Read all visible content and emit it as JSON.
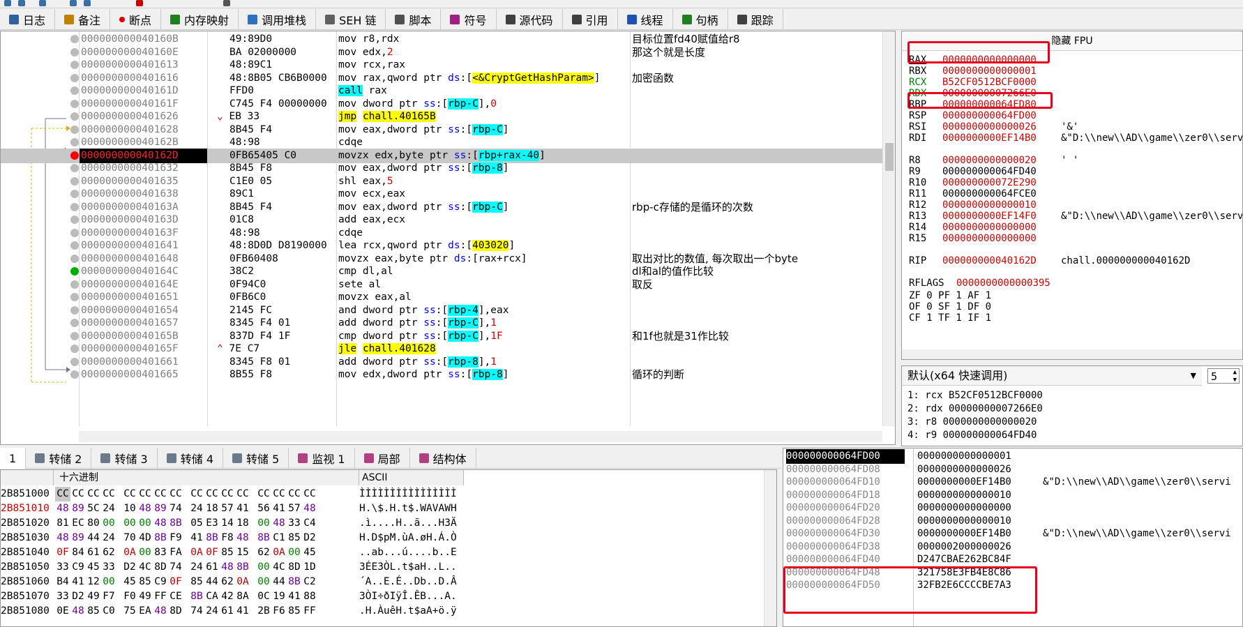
{
  "toolbar_icons": [
    "step-icon",
    "run-icon",
    "pause-icon",
    "step-over-icon",
    "breakpoint-icon",
    "font-icon",
    "hash-icon"
  ],
  "tabs_top": [
    {
      "label": "日志",
      "icon": "log-icon",
      "color": "#3060a0"
    },
    {
      "label": "备注",
      "icon": "notes-icon",
      "color": "#c08000"
    },
    {
      "label": "断点",
      "icon": "breakpoint-dot-icon",
      "color": "#e00000"
    },
    {
      "label": "内存映射",
      "icon": "memory-map-icon",
      "color": "#208020"
    },
    {
      "label": "调用堆栈",
      "icon": "callstack-icon",
      "color": "#3070c0"
    },
    {
      "label": "SEH 链",
      "icon": "seh-icon",
      "color": "#606060"
    },
    {
      "label": "脚本",
      "icon": "script-icon",
      "color": "#505050"
    },
    {
      "label": "符号",
      "icon": "symbol-icon",
      "color": "#a02080"
    },
    {
      "label": "源代码",
      "icon": "source-icon",
      "color": "#404040"
    },
    {
      "label": "引用",
      "icon": "reference-icon",
      "color": "#404040"
    },
    {
      "label": "线程",
      "icon": "thread-icon",
      "color": "#2050b0"
    },
    {
      "label": "句柄",
      "icon": "handle-icon",
      "color": "#208020"
    },
    {
      "label": "跟踪",
      "icon": "trace-icon",
      "color": "#404040"
    }
  ],
  "disasm": [
    {
      "addr": "000000000040160B",
      "bytes": "49:89D0",
      "ins": "mov r8,rdx",
      "comment": "目标位置fd40赋值给r8"
    },
    {
      "addr": "000000000040160E",
      "bytes": "BA 02000000",
      "ins": "mov edx,2",
      "comment": "那这个就是长度"
    },
    {
      "addr": "0000000000401613",
      "bytes": "48:89C1",
      "ins": "mov rcx,rax",
      "comment": ""
    },
    {
      "addr": "0000000000401616",
      "bytes": "48:8B05 CB6B0000",
      "ins": "mov rax,qword ptr ds:[<&CryptGetHashParam>]",
      "comment": "加密函数"
    },
    {
      "addr": "000000000040161D",
      "bytes": "FFD0",
      "ins": "call rax",
      "comment": ""
    },
    {
      "addr": "000000000040161F",
      "bytes": "C745 F4 00000000",
      "ins": "mov dword ptr ss:[rbp-C],0",
      "comment": ""
    },
    {
      "addr": "0000000000401626",
      "bytes": "EB 33",
      "ins": "jmp chall.40165B",
      "comment": ""
    },
    {
      "addr": "0000000000401628",
      "bytes": "8B45 F4",
      "ins": "mov eax,dword ptr ss:[rbp-C]",
      "comment": ""
    },
    {
      "addr": "000000000040162B",
      "bytes": "48:98",
      "ins": "cdqe",
      "comment": ""
    },
    {
      "addr": "000000000040162D",
      "bytes": "0FB65405 C0",
      "ins": "movzx edx,byte ptr ss:[rbp+rax-40]",
      "comment": ""
    },
    {
      "addr": "0000000000401632",
      "bytes": "8B45 F8",
      "ins": "mov eax,dword ptr ss:[rbp-8]",
      "comment": ""
    },
    {
      "addr": "0000000000401635",
      "bytes": "C1E0 05",
      "ins": "shl eax,5",
      "comment": ""
    },
    {
      "addr": "0000000000401638",
      "bytes": "89C1",
      "ins": "mov ecx,eax",
      "comment": ""
    },
    {
      "addr": "000000000040163A",
      "bytes": "8B45 F4",
      "ins": "mov eax,dword ptr ss:[rbp-C]",
      "comment": "rbp-c存储的是循环的次数"
    },
    {
      "addr": "000000000040163D",
      "bytes": "01C8",
      "ins": "add eax,ecx",
      "comment": ""
    },
    {
      "addr": "000000000040163F",
      "bytes": "48:98",
      "ins": "cdqe",
      "comment": ""
    },
    {
      "addr": "0000000000401641",
      "bytes": "48:8D0D D8190000",
      "ins": "lea rcx,qword ptr ds:[403020]",
      "comment": ""
    },
    {
      "addr": "0000000000401648",
      "bytes": "0FB60408",
      "ins": "movzx eax,byte ptr ds:[rax+rcx]",
      "comment": "取出对比的数值, 每次取出一个byte"
    },
    {
      "addr": "000000000040164C",
      "bytes": "38C2",
      "ins": "cmp dl,al",
      "comment": "dl和al的值作比较"
    },
    {
      "addr": "000000000040164E",
      "bytes": "0F94C0",
      "ins": "sete al",
      "comment": "取反"
    },
    {
      "addr": "0000000000401651",
      "bytes": "0FB6C0",
      "ins": "movzx eax,al",
      "comment": ""
    },
    {
      "addr": "0000000000401654",
      "bytes": "2145 FC",
      "ins": "and dword ptr ss:[rbp-4],eax",
      "comment": ""
    },
    {
      "addr": "0000000000401657",
      "bytes": "8345 F4 01",
      "ins": "add dword ptr ss:[rbp-C],1",
      "comment": ""
    },
    {
      "addr": "000000000040165B",
      "bytes": "837D F4 1F",
      "ins": "cmp dword ptr ss:[rbp-C],1F",
      "comment": "和1f也就是31作比较"
    },
    {
      "addr": "000000000040165F",
      "bytes": "7E C7",
      "ins": "jle chall.401628",
      "comment": ""
    },
    {
      "addr": "0000000000401661",
      "bytes": "8345 F8 01",
      "ins": "add dword ptr ss:[rbp-8],1",
      "comment": ""
    },
    {
      "addr": "0000000000401665",
      "bytes": "8B55 F8",
      "ins": "mov edx,dword ptr ss:[rbp-8]",
      "comment": "循环的判断"
    }
  ],
  "regs_header": "隐藏 FPU",
  "registers": [
    {
      "name": "RAX",
      "val": "0000000000000000",
      "desc": ""
    },
    {
      "name": "RBX",
      "val": "0000000000000001",
      "desc": ""
    },
    {
      "name": "RCX",
      "val": "B52CF0512BCF0000",
      "desc": ""
    },
    {
      "name": "RDX",
      "val": "00000000007266E0",
      "desc": ""
    },
    {
      "name": "RBP",
      "val": "000000000064FD80",
      "desc": ""
    },
    {
      "name": "RSP",
      "val": "000000000064FD00",
      "desc": ""
    },
    {
      "name": "RSI",
      "val": "0000000000000026",
      "desc": "'&'"
    },
    {
      "name": "RDI",
      "val": "0000000000EF14B0",
      "desc": "&\"D:\\\\new\\\\AD\\\\game\\\\zer0\\\\service"
    },
    {
      "name": "R8",
      "val": "0000000000000020",
      "desc": "' '"
    },
    {
      "name": "R9",
      "val": "000000000064FD40",
      "desc": ""
    },
    {
      "name": "R10",
      "val": "000000000072E290",
      "desc": ""
    },
    {
      "name": "R11",
      "val": "000000000064FCE0",
      "desc": ""
    },
    {
      "name": "R12",
      "val": "0000000000000010",
      "desc": ""
    },
    {
      "name": "R13",
      "val": "0000000000EF14F0",
      "desc": "&\"D:\\\\new\\\\AD\\\\game\\\\zer0\\\\service"
    },
    {
      "name": "R14",
      "val": "0000000000000000",
      "desc": ""
    },
    {
      "name": "R15",
      "val": "0000000000000000",
      "desc": ""
    },
    {
      "name": "RIP",
      "val": "000000000040162D",
      "desc": "chall.000000000040162D"
    }
  ],
  "rflags": {
    "name": "RFLAGS",
    "val": "0000000000000395"
  },
  "flags_rows": [
    "ZF 0  PF 1  AF 1",
    "OF 0  SF 1  DF 0",
    "CF 1  TF 1  IF 1"
  ],
  "callconv": {
    "label": "默认(x64 快速调用)",
    "count": "5",
    "args": [
      "1: rcx B52CF0512BCF0000",
      "2: rdx 00000000007266E0",
      "3: r8 0000000000000020",
      "4: r9 000000000064FD40"
    ]
  },
  "tabs_bottom": [
    {
      "label": "1",
      "icon": ""
    },
    {
      "label": "转储 2",
      "icon": "dump-icon"
    },
    {
      "label": "转储 3",
      "icon": "dump-icon"
    },
    {
      "label": "转储 4",
      "icon": "dump-icon"
    },
    {
      "label": "转储 5",
      "icon": "dump-icon"
    },
    {
      "label": "监视 1",
      "icon": "watch-icon"
    },
    {
      "label": "局部",
      "icon": "locals-icon"
    },
    {
      "label": "结构体",
      "icon": "struct-icon"
    }
  ],
  "dump_headers": {
    "hex": "十六进制",
    "ascii": "ASCII"
  },
  "dump": [
    {
      "addr": "2B851000",
      "bytes": "CC CC CC CC CC CC CC CC CC CC CC CC CC CC CC CC",
      "ascii": "ÌÌÌÌÌÌÌÌÌÌÌÌÌÌÌÌ"
    },
    {
      "addr": "2B851010",
      "bytes": "48 89 5C 24 10 48 89 74 24 18 57 41 56 41 57 48",
      "ascii": "H.\\$.H.t$.WAVAWH"
    },
    {
      "addr": "2B851020",
      "bytes": "81 EC 80 00 00 00 48 8B 05 E3 14 18 00 48 33 C4",
      "ascii": ".ì....H..ã...H3Ä"
    },
    {
      "addr": "2B851030",
      "bytes": "48 89 44 24 70 4D 8B F9 41 8B F8 48 8B C1 85 D2",
      "ascii": "H.D$pM.ùA.øH.Á.Ò"
    },
    {
      "addr": "2B851040",
      "bytes": "0F 84 61 62 0A 00 83 FA 0A 0F 85 15 62 0A 00 45",
      "ascii": "..ab...ú....b..E"
    },
    {
      "addr": "2B851050",
      "bytes": "33 C9 45 33 D2 4C 8D 74 24 61 48 8B 00 4C 8D 1D",
      "ascii": "3ÉE3ÒL.t$aH..L.."
    },
    {
      "addr": "2B851060",
      "bytes": "B4 41 12 00 45 85 C9 0F 85 44 62 0A 00 44 8B C2",
      "ascii": "´A..E.É..Db..D.Â"
    },
    {
      "addr": "2B851070",
      "bytes": "33 D2 49 F7 F0 49 FF CE 8B CA 42 8A 0C 19 41 88",
      "ascii": "3ÒI÷ðIÿÎ.ÊB...A."
    },
    {
      "addr": "2B851080",
      "bytes": "0E 48 85 C0 75 EA 48 8D 74 24 61 41 2B F6 85 FF",
      "ascii": ".H.ÀuêH.t$aA+ö.ÿ"
    }
  ],
  "stack": [
    {
      "addr": "000000000064FD00",
      "val": "0000000000000001",
      "comment": "",
      "current": true
    },
    {
      "addr": "000000000064FD08",
      "val": "0000000000000026",
      "comment": ""
    },
    {
      "addr": "000000000064FD10",
      "val": "0000000000EF14B0",
      "comment": "&\"D:\\\\new\\\\AD\\\\game\\\\zer0\\\\servi"
    },
    {
      "addr": "000000000064FD18",
      "val": "0000000000000010",
      "comment": ""
    },
    {
      "addr": "000000000064FD20",
      "val": "0000000000000000",
      "comment": ""
    },
    {
      "addr": "000000000064FD28",
      "val": "0000000000000010",
      "comment": ""
    },
    {
      "addr": "000000000064FD30",
      "val": "0000000000EF14B0",
      "comment": "&\"D:\\\\new\\\\AD\\\\game\\\\zer0\\\\servi"
    },
    {
      "addr": "000000000064FD38",
      "val": "0000002000000026",
      "comment": ""
    },
    {
      "addr": "000000000064FD40",
      "val": "D247CBAE262BC84F",
      "comment": ""
    },
    {
      "addr": "000000000064FD48",
      "val": "321758E3FB4E8C86",
      "comment": ""
    },
    {
      "addr": "000000000064FD50",
      "val": "32FB2E6CCCCBE7A3",
      "comment": ""
    }
  ]
}
